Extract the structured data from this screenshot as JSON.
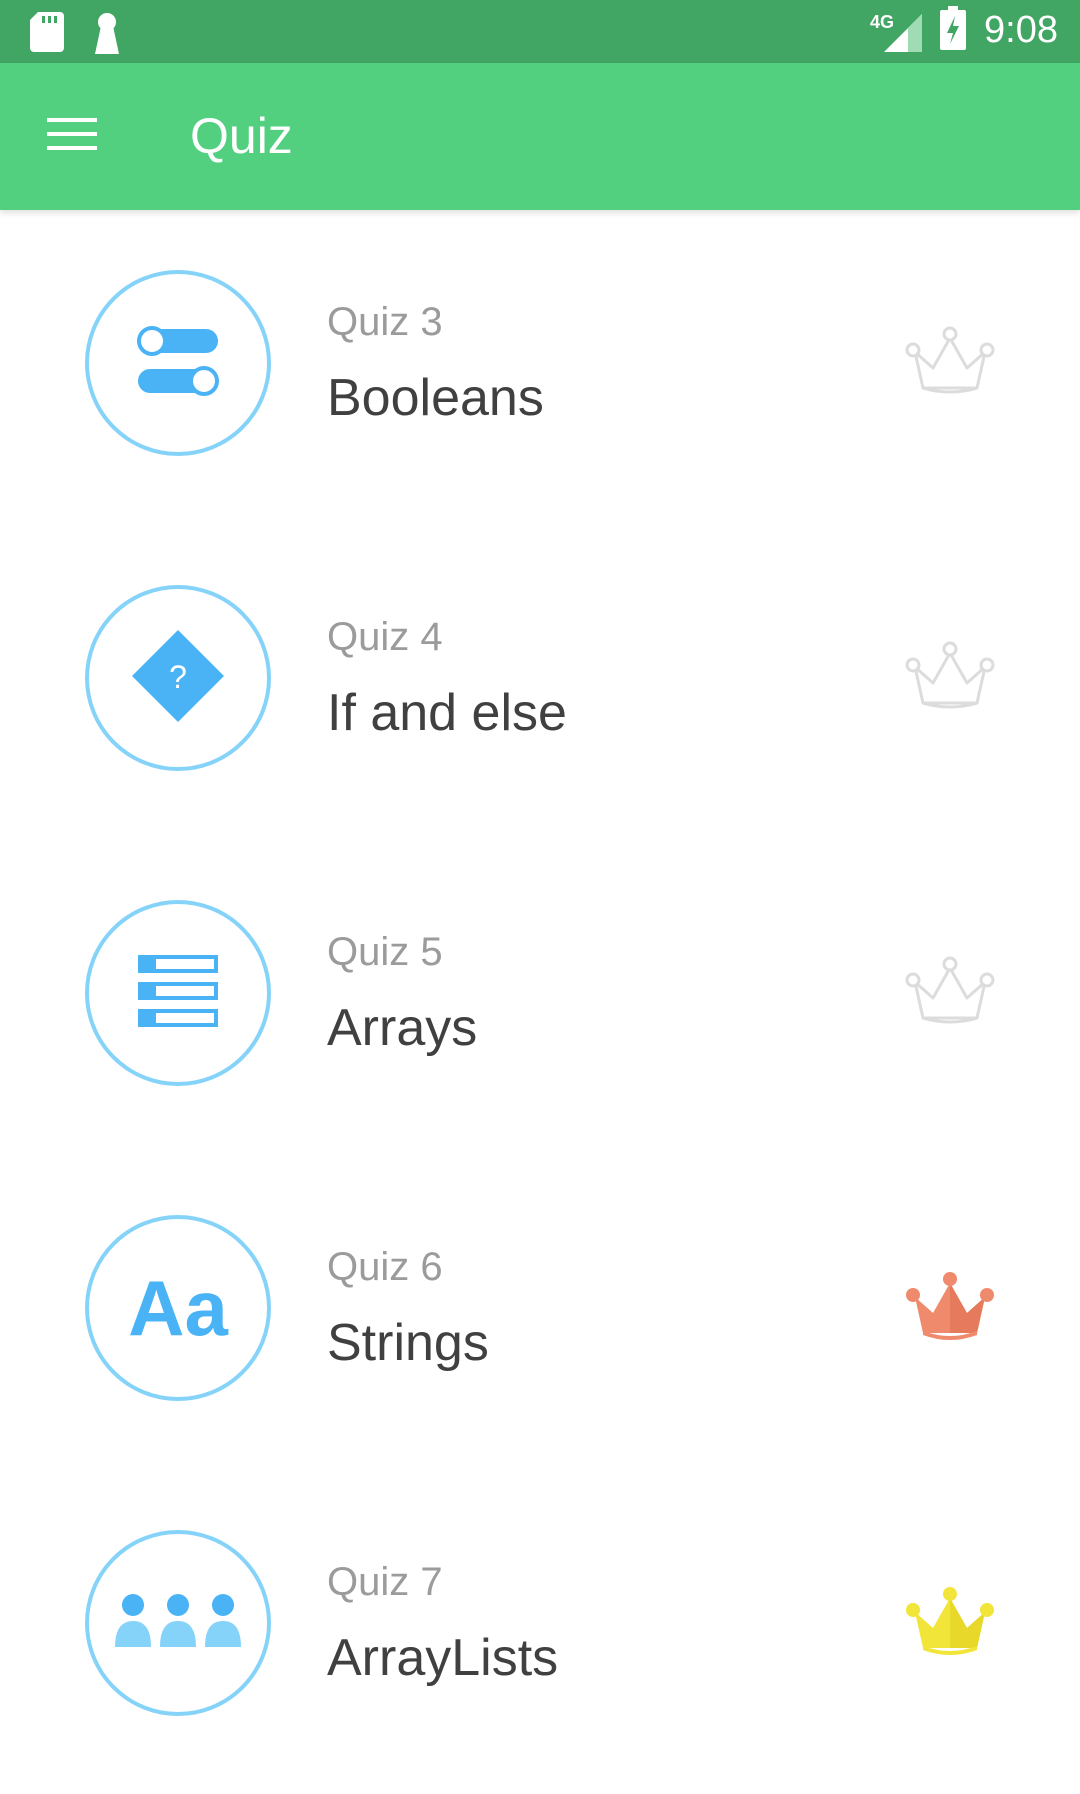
{
  "status_bar": {
    "network": "4G",
    "time": "9:08",
    "icons": [
      "sd-card-icon",
      "keyhole-icon",
      "signal-icon",
      "battery-charging-icon"
    ]
  },
  "app_bar": {
    "title": "Quiz",
    "menu_icon": "hamburger-menu-icon"
  },
  "quizzes": [
    {
      "number": "Quiz 3",
      "title": "Booleans",
      "icon": "toggle-switches-icon",
      "crown": "empty",
      "crown_color": "#dcdcdc"
    },
    {
      "number": "Quiz 4",
      "title": "If and else",
      "icon": "question-diamond-icon",
      "crown": "empty",
      "crown_color": "#dcdcdc"
    },
    {
      "number": "Quiz 5",
      "title": "Arrays",
      "icon": "stacked-bars-icon",
      "crown": "empty",
      "crown_color": "#dcdcdc"
    },
    {
      "number": "Quiz 6",
      "title": "Strings",
      "icon": "text-aa-icon",
      "icon_text": "Aa",
      "crown": "filled",
      "crown_color": "#ef8a6c"
    },
    {
      "number": "Quiz 7",
      "title": "ArrayLists",
      "icon": "people-group-icon",
      "crown": "filled",
      "crown_color": "#f2e53a"
    }
  ],
  "colors": {
    "status_bar": "#41a563",
    "app_bar": "#52d07f",
    "icon_ring": "#86d3fa",
    "icon_fill": "#4ab3f6"
  }
}
